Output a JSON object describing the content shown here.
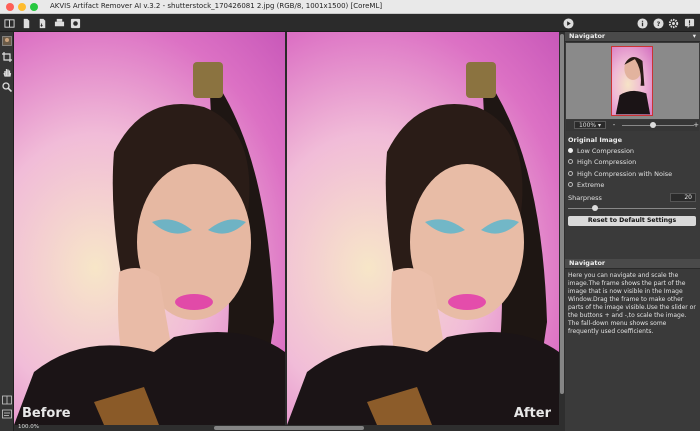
{
  "window": {
    "title": "AKVIS Artifact Remover AI v.3.2 - shutterstock_170426081 2.jpg (RGB/8, 1001x1500) [CoreML]"
  },
  "toolbar": {
    "left_icons": [
      "before-after-icon",
      "open-file-icon",
      "save-file-icon",
      "print-icon",
      "share-icon"
    ],
    "run_icon": "play-icon",
    "right_icons": [
      "info-icon",
      "help-icon",
      "settings-icon",
      "notification-icon"
    ]
  },
  "tools": [
    "navigator-small-icon",
    "crop-icon",
    "hand-icon",
    "zoom-icon"
  ],
  "view": {
    "before_label": "Before",
    "after_label": "After",
    "zoom_status": "100.0%"
  },
  "navigator": {
    "title": "Navigator",
    "zoom_value": "100% ▾",
    "zoom_out": "-",
    "zoom_in": "+"
  },
  "settings": {
    "section_title": "Original Image",
    "options": [
      {
        "label": "Low Compression",
        "selected": true
      },
      {
        "label": "High Compression",
        "selected": false
      },
      {
        "label": "High Compression with Noise",
        "selected": false
      },
      {
        "label": "Extreme",
        "selected": false
      }
    ],
    "sharpness_label": "Sharpness",
    "sharpness_value": "20",
    "reset_label": "Reset to Default Settings"
  },
  "help": {
    "title": "Navigator",
    "text": "Here you can navigate and scale the image.The frame shows the part of the image that is now visible in the Image Window.Drag the frame to make other parts of the image visible.Use the slider or the buttons + and -,to scale the image. The fall-down menu shows some frequently used coefficients."
  },
  "colors": {
    "panel_bg": "#3a3a3a",
    "toolbar_bg": "#2b2b2b",
    "photo_pink": "#dc71c4",
    "photo_cream": "#f7e6c8"
  }
}
